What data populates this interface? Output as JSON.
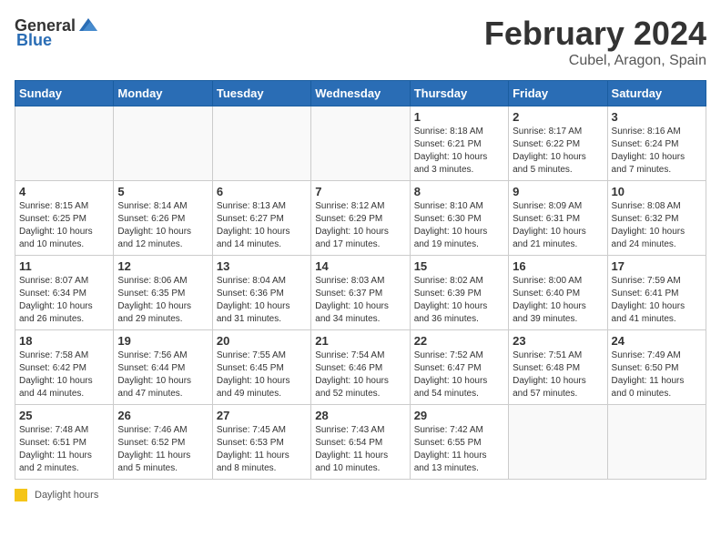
{
  "header": {
    "logo_general": "General",
    "logo_blue": "Blue",
    "month": "February 2024",
    "location": "Cubel, Aragon, Spain"
  },
  "days_of_week": [
    "Sunday",
    "Monday",
    "Tuesday",
    "Wednesday",
    "Thursday",
    "Friday",
    "Saturday"
  ],
  "footer": {
    "daylight_label": "Daylight hours"
  },
  "weeks": [
    [
      {
        "day": "",
        "info": ""
      },
      {
        "day": "",
        "info": ""
      },
      {
        "day": "",
        "info": ""
      },
      {
        "day": "",
        "info": ""
      },
      {
        "day": "1",
        "info": "Sunrise: 8:18 AM\nSunset: 6:21 PM\nDaylight: 10 hours\nand 3 minutes."
      },
      {
        "day": "2",
        "info": "Sunrise: 8:17 AM\nSunset: 6:22 PM\nDaylight: 10 hours\nand 5 minutes."
      },
      {
        "day": "3",
        "info": "Sunrise: 8:16 AM\nSunset: 6:24 PM\nDaylight: 10 hours\nand 7 minutes."
      }
    ],
    [
      {
        "day": "4",
        "info": "Sunrise: 8:15 AM\nSunset: 6:25 PM\nDaylight: 10 hours\nand 10 minutes."
      },
      {
        "day": "5",
        "info": "Sunrise: 8:14 AM\nSunset: 6:26 PM\nDaylight: 10 hours\nand 12 minutes."
      },
      {
        "day": "6",
        "info": "Sunrise: 8:13 AM\nSunset: 6:27 PM\nDaylight: 10 hours\nand 14 minutes."
      },
      {
        "day": "7",
        "info": "Sunrise: 8:12 AM\nSunset: 6:29 PM\nDaylight: 10 hours\nand 17 minutes."
      },
      {
        "day": "8",
        "info": "Sunrise: 8:10 AM\nSunset: 6:30 PM\nDaylight: 10 hours\nand 19 minutes."
      },
      {
        "day": "9",
        "info": "Sunrise: 8:09 AM\nSunset: 6:31 PM\nDaylight: 10 hours\nand 21 minutes."
      },
      {
        "day": "10",
        "info": "Sunrise: 8:08 AM\nSunset: 6:32 PM\nDaylight: 10 hours\nand 24 minutes."
      }
    ],
    [
      {
        "day": "11",
        "info": "Sunrise: 8:07 AM\nSunset: 6:34 PM\nDaylight: 10 hours\nand 26 minutes."
      },
      {
        "day": "12",
        "info": "Sunrise: 8:06 AM\nSunset: 6:35 PM\nDaylight: 10 hours\nand 29 minutes."
      },
      {
        "day": "13",
        "info": "Sunrise: 8:04 AM\nSunset: 6:36 PM\nDaylight: 10 hours\nand 31 minutes."
      },
      {
        "day": "14",
        "info": "Sunrise: 8:03 AM\nSunset: 6:37 PM\nDaylight: 10 hours\nand 34 minutes."
      },
      {
        "day": "15",
        "info": "Sunrise: 8:02 AM\nSunset: 6:39 PM\nDaylight: 10 hours\nand 36 minutes."
      },
      {
        "day": "16",
        "info": "Sunrise: 8:00 AM\nSunset: 6:40 PM\nDaylight: 10 hours\nand 39 minutes."
      },
      {
        "day": "17",
        "info": "Sunrise: 7:59 AM\nSunset: 6:41 PM\nDaylight: 10 hours\nand 41 minutes."
      }
    ],
    [
      {
        "day": "18",
        "info": "Sunrise: 7:58 AM\nSunset: 6:42 PM\nDaylight: 10 hours\nand 44 minutes."
      },
      {
        "day": "19",
        "info": "Sunrise: 7:56 AM\nSunset: 6:44 PM\nDaylight: 10 hours\nand 47 minutes."
      },
      {
        "day": "20",
        "info": "Sunrise: 7:55 AM\nSunset: 6:45 PM\nDaylight: 10 hours\nand 49 minutes."
      },
      {
        "day": "21",
        "info": "Sunrise: 7:54 AM\nSunset: 6:46 PM\nDaylight: 10 hours\nand 52 minutes."
      },
      {
        "day": "22",
        "info": "Sunrise: 7:52 AM\nSunset: 6:47 PM\nDaylight: 10 hours\nand 54 minutes."
      },
      {
        "day": "23",
        "info": "Sunrise: 7:51 AM\nSunset: 6:48 PM\nDaylight: 10 hours\nand 57 minutes."
      },
      {
        "day": "24",
        "info": "Sunrise: 7:49 AM\nSunset: 6:50 PM\nDaylight: 11 hours\nand 0 minutes."
      }
    ],
    [
      {
        "day": "25",
        "info": "Sunrise: 7:48 AM\nSunset: 6:51 PM\nDaylight: 11 hours\nand 2 minutes."
      },
      {
        "day": "26",
        "info": "Sunrise: 7:46 AM\nSunset: 6:52 PM\nDaylight: 11 hours\nand 5 minutes."
      },
      {
        "day": "27",
        "info": "Sunrise: 7:45 AM\nSunset: 6:53 PM\nDaylight: 11 hours\nand 8 minutes."
      },
      {
        "day": "28",
        "info": "Sunrise: 7:43 AM\nSunset: 6:54 PM\nDaylight: 11 hours\nand 10 minutes."
      },
      {
        "day": "29",
        "info": "Sunrise: 7:42 AM\nSunset: 6:55 PM\nDaylight: 11 hours\nand 13 minutes."
      },
      {
        "day": "",
        "info": ""
      },
      {
        "day": "",
        "info": ""
      }
    ]
  ]
}
